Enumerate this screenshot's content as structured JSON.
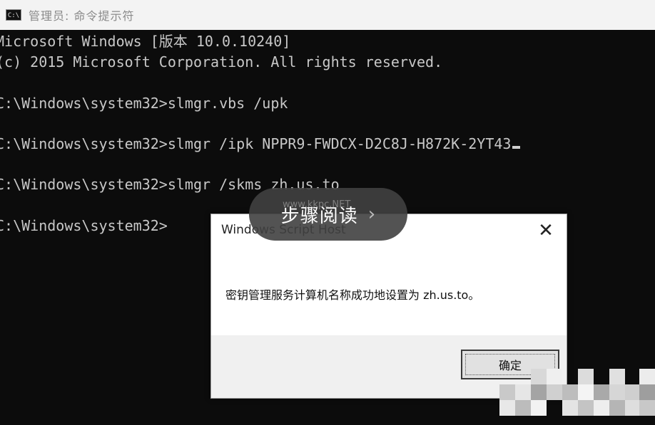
{
  "window": {
    "title": "管理员: 命令提示符",
    "icon": "cmd-console-icon"
  },
  "console": {
    "lines": [
      "Microsoft Windows [版本 10.0.10240]",
      "(c) 2015 Microsoft Corporation. All rights reserved.",
      "",
      "C:\\Windows\\system32>slmgr.vbs /upk",
      "",
      "C:\\Windows\\system32>slmgr /ipk NPPR9-FWDCX-D2C8J-H872K-2YT43",
      "",
      "C:\\Windows\\system32>slmgr /skms zh.us.to",
      "",
      "C:\\Windows\\system32>"
    ]
  },
  "dialog": {
    "title": "Windows Script Host",
    "message": "密钥管理服务计算机名称成功地设置为 zh.us.to。",
    "ok_label": "确定",
    "close_icon": "close-icon"
  },
  "overlay": {
    "label": "步骤阅读",
    "watermark": "www.kkpc.NET"
  },
  "colors": {
    "console_bg": "#0c0c0c",
    "console_text": "#c8c8c8",
    "titlebar_bg": "#f3f3f3",
    "dialog_bg": "#f0f0f0"
  }
}
